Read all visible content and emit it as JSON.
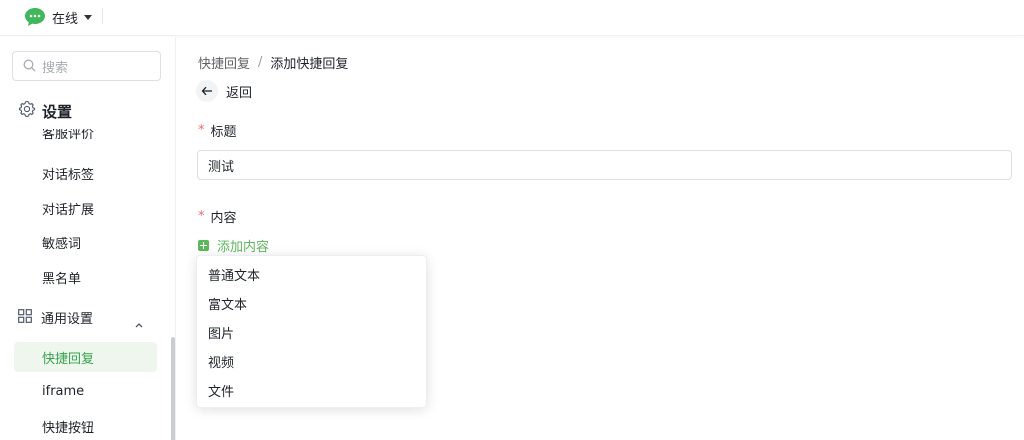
{
  "topbar": {
    "status_label": "在线"
  },
  "sidebar": {
    "search_placeholder": "搜索",
    "section_title": "设置",
    "items": [
      {
        "label": "客服评价"
      },
      {
        "label": "对话标签"
      },
      {
        "label": "对话扩展"
      },
      {
        "label": "敏感词"
      },
      {
        "label": "黑名单"
      }
    ],
    "group_title": "通用设置",
    "group_items": [
      {
        "label": "快捷回复",
        "active": true
      },
      {
        "label": "iframe"
      },
      {
        "label": "快捷按钮"
      }
    ]
  },
  "main": {
    "breadcrumb": {
      "parent": "快捷回复",
      "separator": "/",
      "current": "添加快捷回复"
    },
    "back_label": "返回",
    "title_field": {
      "required_mark": "*",
      "label": "标题",
      "value": "测试"
    },
    "content_field": {
      "required_mark": "*",
      "label": "内容"
    },
    "add_content_label": "添加内容",
    "dropdown_options": [
      "普通文本",
      "富文本",
      "图片",
      "视频",
      "文件"
    ]
  },
  "colors": {
    "accent_green": "#38a34e",
    "active_bg": "#eef6ee",
    "required_red": "#f56c6c"
  }
}
